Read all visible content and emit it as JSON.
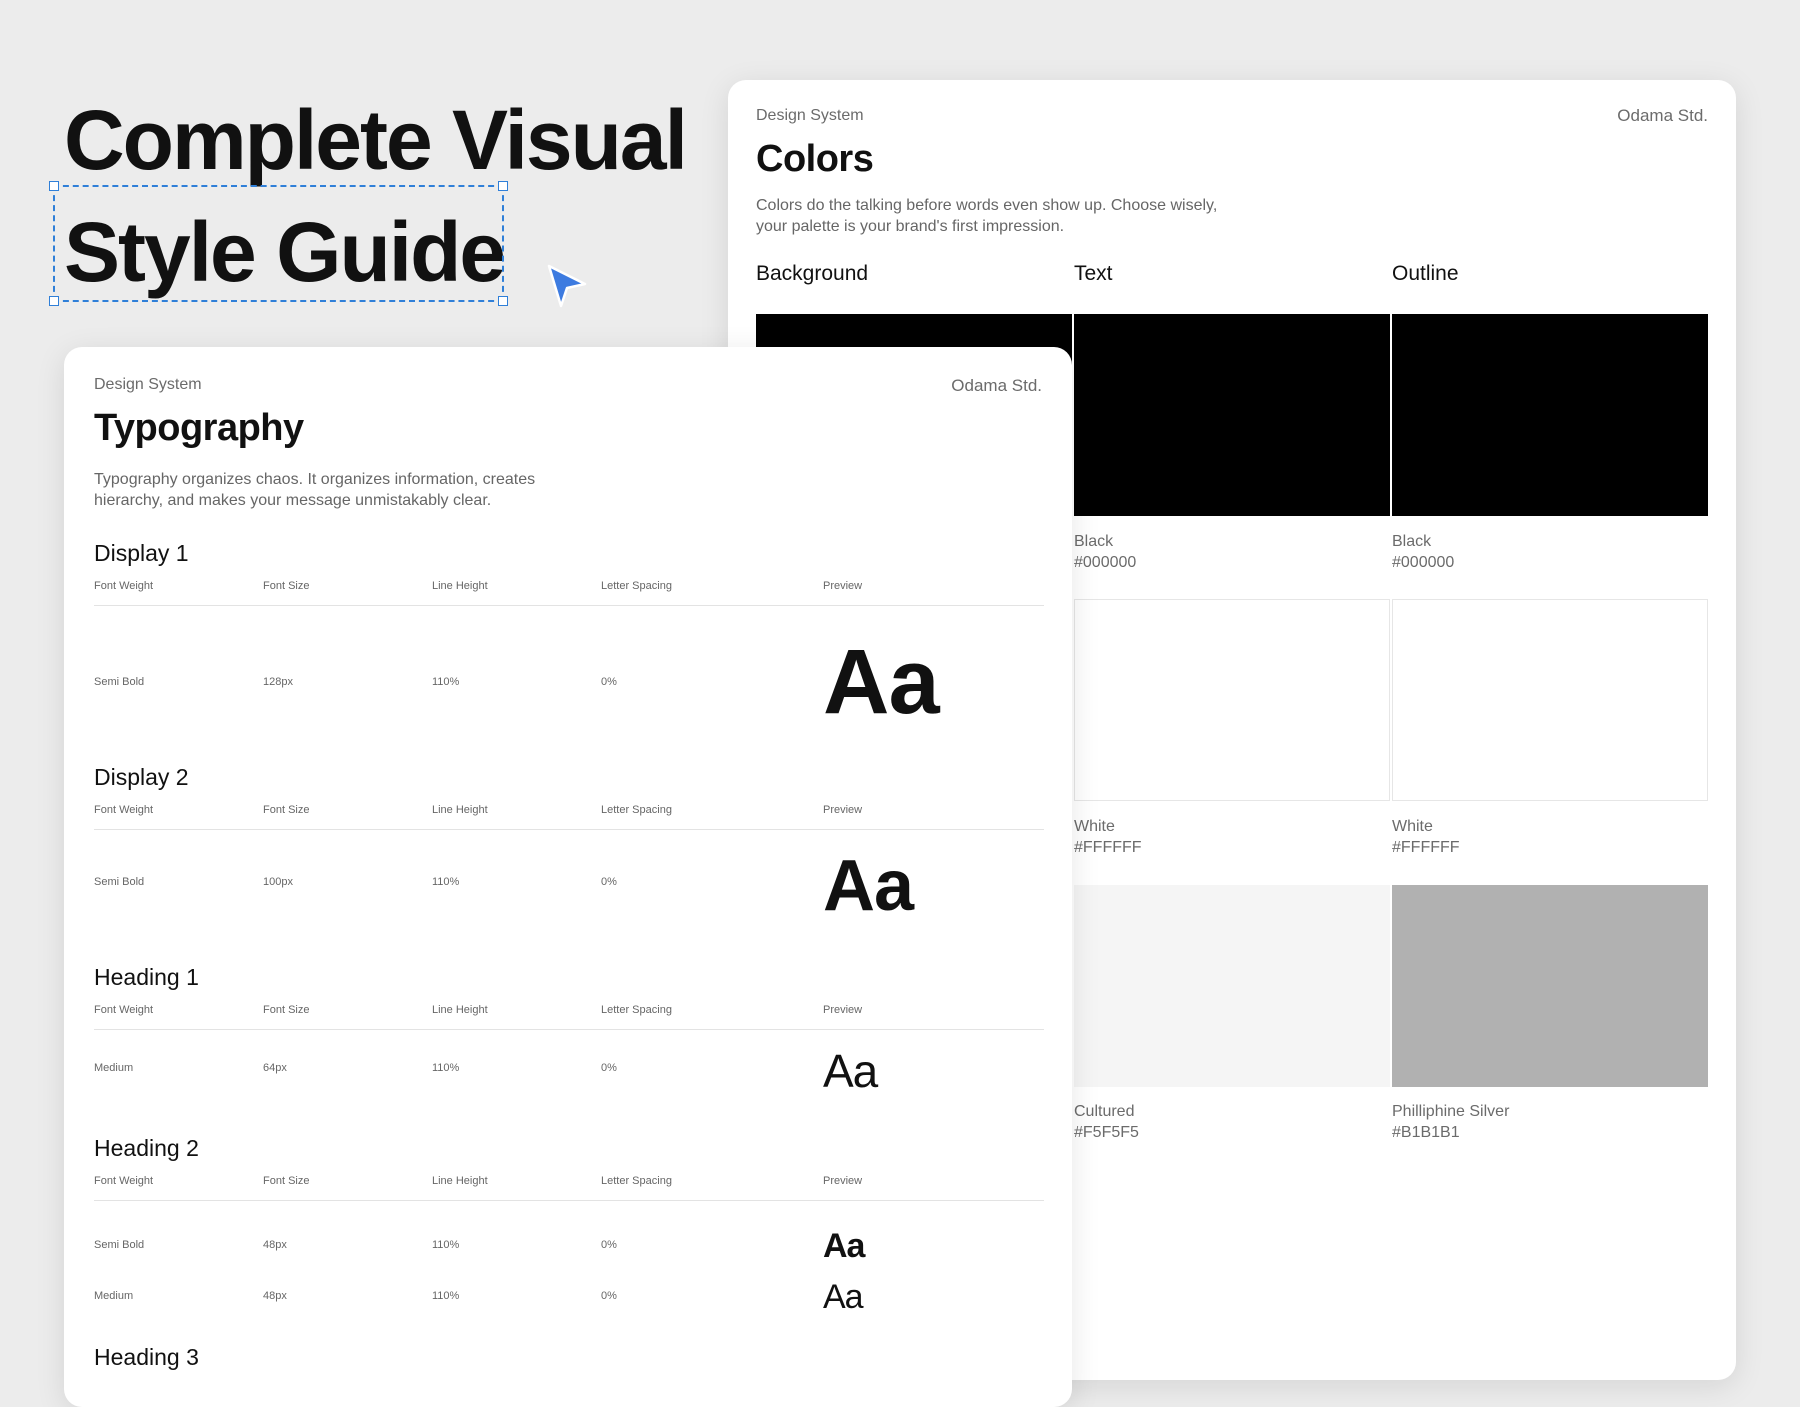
{
  "hero": {
    "line1": "Complete Visual",
    "line2": "Style Guide"
  },
  "colors_card": {
    "eyebrow": "Design System",
    "brand": "Odama Std.",
    "title": "Colors",
    "description_line1": "Colors do the talking before words even show up. Choose wisely,",
    "description_line2": "your palette is your brand's first impression.",
    "columns": [
      "Background",
      "Text",
      "Outline"
    ],
    "rows": [
      {
        "name": "Black",
        "hex": "#000000",
        "color": "#000000"
      },
      {
        "name": "White",
        "hex": "#FFFFFF",
        "color": "#FFFFFF"
      },
      {
        "name_text": "Cultured",
        "hex_text": "#F5F5F5",
        "color_text": "#F5F5F5",
        "name_outline": "Philliphine Silver",
        "hex_outline": "#B1B1B1",
        "color_outline": "#B1B1B1"
      }
    ]
  },
  "typography_card": {
    "eyebrow": "Design System",
    "brand": "Odama Std.",
    "title": "Typography",
    "description_line1": "Typography organizes chaos. It organizes information, creates",
    "description_line2": "hierarchy, and makes your message unmistakably clear.",
    "column_headers": [
      "Font Weight",
      "Font Size",
      "Line Height",
      "Letter Spacing",
      "Preview"
    ],
    "sections": [
      {
        "name": "Display 1",
        "rows": [
          {
            "weight": "Semi Bold",
            "size": "128px",
            "line_height": "110%",
            "letter_spacing": "0%",
            "preview": "Aa"
          }
        ]
      },
      {
        "name": "Display 2",
        "rows": [
          {
            "weight": "Semi Bold",
            "size": "100px",
            "line_height": "110%",
            "letter_spacing": "0%",
            "preview": "Aa"
          }
        ]
      },
      {
        "name": "Heading 1",
        "rows": [
          {
            "weight": "Medium",
            "size": "64px",
            "line_height": "110%",
            "letter_spacing": "0%",
            "preview": "Aa"
          }
        ]
      },
      {
        "name": "Heading 2",
        "rows": [
          {
            "weight": "Semi Bold",
            "size": "48px",
            "line_height": "110%",
            "letter_spacing": "0%",
            "preview": "Aa"
          },
          {
            "weight": "Medium",
            "size": "48px",
            "line_height": "110%",
            "letter_spacing": "0%",
            "preview": "Aa"
          }
        ]
      },
      {
        "name": "Heading 3",
        "rows": []
      }
    ]
  },
  "colors": {
    "accent": "#2f7fd8",
    "cursor": "#3d7be0",
    "page_bg": "#ececec"
  }
}
